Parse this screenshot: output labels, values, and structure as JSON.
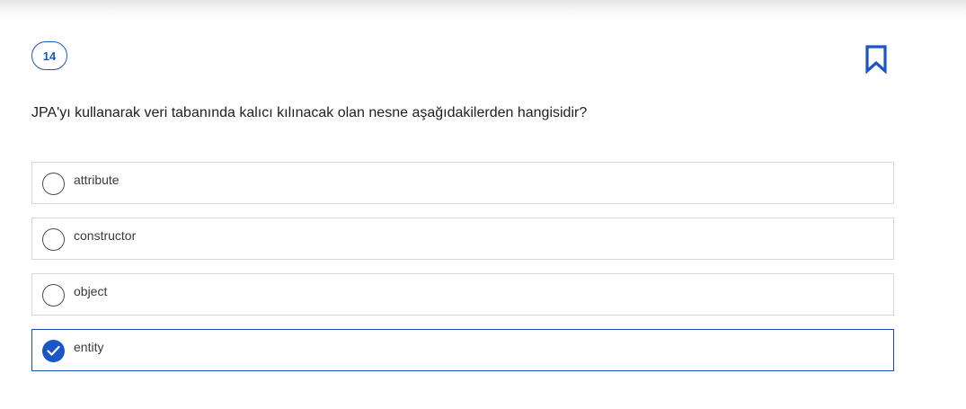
{
  "question": {
    "number": "14",
    "text": "JPA'yı kullanarak veri tabanında kalıcı kılınacak olan nesne aşağıdakilerden hangisidir?"
  },
  "options": [
    {
      "label": "attribute",
      "selected": false
    },
    {
      "label": "constructor",
      "selected": false
    },
    {
      "label": "object",
      "selected": false
    },
    {
      "label": "entity",
      "selected": true
    }
  ],
  "icons": {
    "bookmark": "bookmark-icon",
    "check": "check-icon"
  },
  "colors": {
    "accent": "#1a56c4",
    "selected_border": "#1a4ab0",
    "option_border": "#d7d7d7",
    "text": "#212121"
  }
}
